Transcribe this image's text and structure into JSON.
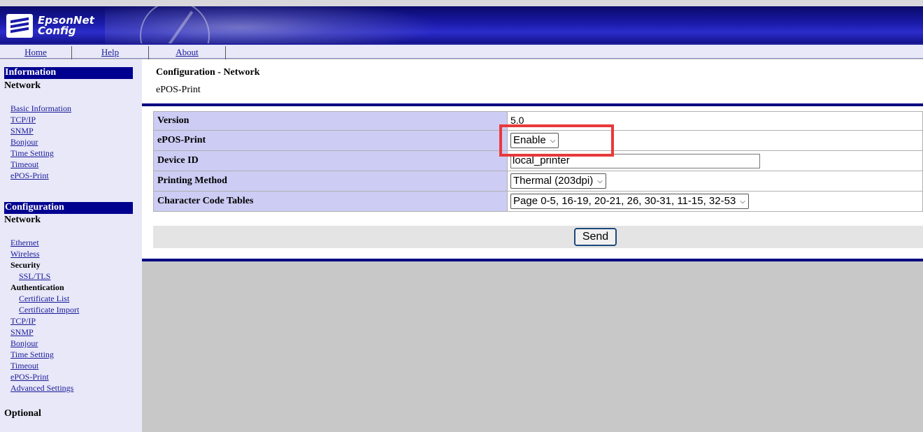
{
  "header": {
    "logo_line1": "EpsonNet",
    "logo_line2": "Config"
  },
  "topnav": [
    "Home",
    "Help",
    "About"
  ],
  "sidebar": {
    "info_heading": "Information",
    "info_sub": "Network",
    "info_links": [
      "Basic Information",
      "TCP/IP",
      "SNMP",
      "Bonjour",
      "Time Setting",
      "Timeout",
      "ePOS-Print"
    ],
    "config_heading": "Configuration",
    "config_sub": "Network",
    "ethernet": "Ethernet",
    "wireless": "Wireless",
    "security": "Security",
    "ssl_tls": "SSL/TLS",
    "authentication": "Authentication",
    "certificate_list": "Certificate List",
    "certificate_import": "Certificate Import",
    "config_links": [
      "TCP/IP",
      "SNMP",
      "Bonjour",
      "Time Setting",
      "Timeout",
      "ePOS-Print",
      "Advanced Settings"
    ],
    "optional": "Optional"
  },
  "main": {
    "title": "Configuration - Network",
    "subtitle": "ePOS-Print",
    "rows": [
      {
        "label": "Version",
        "value": "5.0"
      },
      {
        "label": "ePOS-Print",
        "value": "Enable"
      },
      {
        "label": "Device ID",
        "value": "local_printer"
      },
      {
        "label": "Printing Method",
        "value": "Thermal (203dpi)"
      },
      {
        "label": "Character Code Tables",
        "value": "Page 0-5, 16-19, 20-21, 26, 30-31, 11-15, 32-53"
      }
    ],
    "send_label": "Send"
  },
  "colors": {
    "highlight": "#e8393b",
    "header_blue": "#000090",
    "key_cell": "#ccccf4"
  }
}
